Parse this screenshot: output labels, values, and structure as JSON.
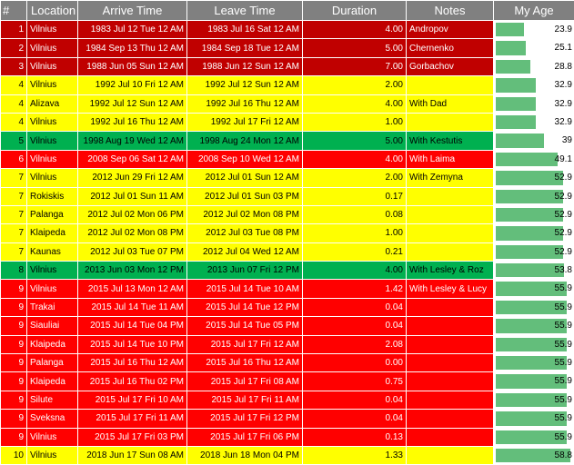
{
  "colors": {
    "red": "#ff0000",
    "dark_red": "#c00000",
    "yellow": "#ffff00",
    "green": "#00b050",
    "databar": "#63be7b",
    "header": "#808080"
  },
  "headers": {
    "num": "#",
    "location": "Location",
    "arrive": "Arrive Time",
    "leave": "Leave Time",
    "duration": "Duration",
    "notes": "Notes",
    "age": "My Age"
  },
  "age_max": 60,
  "rows": [
    {
      "num": "1",
      "location": "Vilnius",
      "arrive": "1983 Jul 12 Tue 12 AM",
      "leave": "1983 Jul 16 Sat 12 AM",
      "duration": "4.00",
      "notes": "Andropov",
      "age": "23.9",
      "color": "dark"
    },
    {
      "num": "2",
      "location": "Vilnius",
      "arrive": "1984 Sep 13 Thu 12 AM",
      "leave": "1984 Sep 18 Tue 12 AM",
      "duration": "5.00",
      "notes": "Chernenko",
      "age": "25.1",
      "color": "dark"
    },
    {
      "num": "3",
      "location": "Vilnius",
      "arrive": "1988 Jun 05 Sun 12 AM",
      "leave": "1988 Jun 12 Sun 12 AM",
      "duration": "7.00",
      "notes": "Gorbachov",
      "age": "28.8",
      "color": "dark"
    },
    {
      "num": "4",
      "location": "Vilnius",
      "arrive": "1992 Jul 10 Fri 12 AM",
      "leave": "1992 Jul 12 Sun 12 AM",
      "duration": "2.00",
      "notes": "",
      "age": "32.9",
      "color": "yellow"
    },
    {
      "num": "4",
      "location": "Alizava",
      "arrive": "1992 Jul 12 Sun 12 AM",
      "leave": "1992 Jul 16 Thu 12 AM",
      "duration": "4.00",
      "notes": "With Dad",
      "age": "32.9",
      "color": "yellow"
    },
    {
      "num": "4",
      "location": "Vilnius",
      "arrive": "1992 Jul 16 Thu 12 AM",
      "leave": "1992 Jul 17 Fri 12 AM",
      "duration": "1.00",
      "notes": "",
      "age": "32.9",
      "color": "yellow"
    },
    {
      "num": "5",
      "location": "Vilnius",
      "arrive": "1998 Aug 19 Wed 12 AM",
      "leave": "1998 Aug 24 Mon 12 AM",
      "duration": "5.00",
      "notes": "With Kestutis",
      "age": "39",
      "color": "green"
    },
    {
      "num": "6",
      "location": "Vilnius",
      "arrive": "2008 Sep 06 Sat 12 AM",
      "leave": "2008 Sep 10 Wed 12 AM",
      "duration": "4.00",
      "notes": "With Laima",
      "age": "49.1",
      "color": "red"
    },
    {
      "num": "7",
      "location": "Vilnius",
      "arrive": "2012 Jun 29 Fri 12 AM",
      "leave": "2012 Jul 01 Sun 12 AM",
      "duration": "2.00",
      "notes": "With Zemyna",
      "age": "52.9",
      "color": "yellow"
    },
    {
      "num": "7",
      "location": "Rokiskis",
      "arrive": "2012 Jul 01 Sun 11 AM",
      "leave": "2012 Jul 01 Sun 03 PM",
      "duration": "0.17",
      "notes": "",
      "age": "52.9",
      "color": "yellow"
    },
    {
      "num": "7",
      "location": "Palanga",
      "arrive": "2012 Jul 02 Mon 06 PM",
      "leave": "2012 Jul 02 Mon 08 PM",
      "duration": "0.08",
      "notes": "",
      "age": "52.9",
      "color": "yellow"
    },
    {
      "num": "7",
      "location": "Klaipeda",
      "arrive": "2012 Jul 02 Mon 08 PM",
      "leave": "2012 Jul 03 Tue 08 PM",
      "duration": "1.00",
      "notes": "",
      "age": "52.9",
      "color": "yellow"
    },
    {
      "num": "7",
      "location": "Kaunas",
      "arrive": "2012 Jul 03 Tue 07 PM",
      "leave": "2012 Jul 04 Wed 12 AM",
      "duration": "0.21",
      "notes": "",
      "age": "52.9",
      "color": "yellow"
    },
    {
      "num": "8",
      "location": "Vilnius",
      "arrive": "2013 Jun 03 Mon 12 PM",
      "leave": "2013 Jun 07 Fri 12 PM",
      "duration": "4.00",
      "notes": "With Lesley & Roz",
      "age": "53.8",
      "color": "green"
    },
    {
      "num": "9",
      "location": "Vilnius",
      "arrive": "2015 Jul 13 Mon 12 AM",
      "leave": "2015 Jul 14 Tue 10 AM",
      "duration": "1.42",
      "notes": "With Lesley & Lucy",
      "age": "55.9",
      "color": "red"
    },
    {
      "num": "9",
      "location": "Trakai",
      "arrive": "2015 Jul 14 Tue 11 AM",
      "leave": "2015 Jul 14 Tue 12 PM",
      "duration": "0.04",
      "notes": "",
      "age": "55.9",
      "color": "red"
    },
    {
      "num": "9",
      "location": "Siauliai",
      "arrive": "2015 Jul 14 Tue 04 PM",
      "leave": "2015 Jul 14 Tue 05 PM",
      "duration": "0.04",
      "notes": "",
      "age": "55.9",
      "color": "red"
    },
    {
      "num": "9",
      "location": "Klaipeda",
      "arrive": "2015 Jul 14 Tue 10 PM",
      "leave": "2015 Jul 17 Fri 12 AM",
      "duration": "2.08",
      "notes": "",
      "age": "55.9",
      "color": "red"
    },
    {
      "num": "9",
      "location": "Palanga",
      "arrive": "2015 Jul 16 Thu 12 AM",
      "leave": "2015 Jul 16 Thu 12 AM",
      "duration": "0.00",
      "notes": "",
      "age": "55.9",
      "color": "red"
    },
    {
      "num": "9",
      "location": "Klaipeda",
      "arrive": "2015 Jul 16 Thu 02 PM",
      "leave": "2015 Jul 17 Fri 08 AM",
      "duration": "0.75",
      "notes": "",
      "age": "55.9",
      "color": "red"
    },
    {
      "num": "9",
      "location": "Silute",
      "arrive": "2015 Jul 17 Fri 10 AM",
      "leave": "2015 Jul 17 Fri 11 AM",
      "duration": "0.04",
      "notes": "",
      "age": "55.9",
      "color": "red"
    },
    {
      "num": "9",
      "location": "Sveksna",
      "arrive": "2015 Jul 17 Fri 11 AM",
      "leave": "2015 Jul 17 Fri 12 PM",
      "duration": "0.04",
      "notes": "",
      "age": "55.9",
      "color": "red"
    },
    {
      "num": "9",
      "location": "Vilnius",
      "arrive": "2015 Jul 17 Fri 03 PM",
      "leave": "2015 Jul 17 Fri 06 PM",
      "duration": "0.13",
      "notes": "",
      "age": "55.9",
      "color": "red"
    },
    {
      "num": "10",
      "location": "Vilnius",
      "arrive": "2018 Jun 17 Sun 08 AM",
      "leave": "2018 Jun 18 Mon 04 PM",
      "duration": "1.33",
      "notes": "",
      "age": "58.8",
      "color": "yellow"
    }
  ]
}
